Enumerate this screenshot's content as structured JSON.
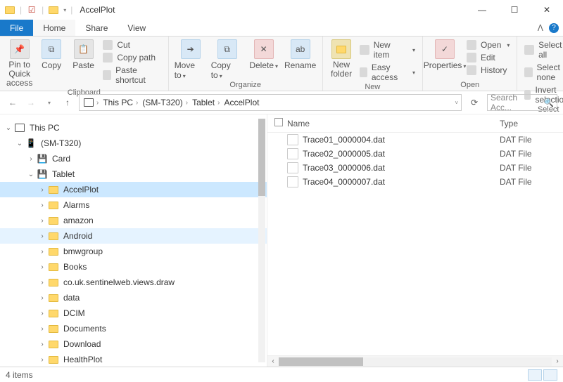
{
  "title": "AccelPlot",
  "tabs": {
    "file": "File",
    "home": "Home",
    "share": "Share",
    "view": "View"
  },
  "ribbon": {
    "clipboard": {
      "label": "Clipboard",
      "pin": "Pin to Quick access",
      "copy": "Copy",
      "paste": "Paste",
      "cut": "Cut",
      "copypath": "Copy path",
      "pasteshortcut": "Paste shortcut"
    },
    "organize": {
      "label": "Organize",
      "moveto": "Move to",
      "copyto": "Copy to",
      "delete": "Delete",
      "rename": "Rename"
    },
    "new": {
      "label": "New",
      "newfolder": "New folder",
      "newitem": "New item",
      "easyaccess": "Easy access"
    },
    "open": {
      "label": "Open",
      "properties": "Properties",
      "open": "Open",
      "edit": "Edit",
      "history": "History"
    },
    "select": {
      "label": "Select",
      "selectall": "Select all",
      "selectnone": "Select none",
      "invert": "Invert selection"
    }
  },
  "path": [
    "This PC",
    "(SM-T320)",
    "Tablet",
    "AccelPlot"
  ],
  "search_placeholder": "Search Acc...",
  "tree": {
    "thispc": "This PC",
    "device": "(SM-T320)",
    "card": "Card",
    "tablet": "Tablet",
    "folders": [
      "AccelPlot",
      "Alarms",
      "amazon",
      "Android",
      "bmwgroup",
      "Books",
      "co.uk.sentinelweb.views.draw",
      "data",
      "DCIM",
      "Documents",
      "Download",
      "HealthPlot"
    ]
  },
  "columns": {
    "name": "Name",
    "type": "Type"
  },
  "files": [
    {
      "name": "Trace01_0000004.dat",
      "type": "DAT File"
    },
    {
      "name": "Trace02_0000005.dat",
      "type": "DAT File"
    },
    {
      "name": "Trace03_0000006.dat",
      "type": "DAT File"
    },
    {
      "name": "Trace04_0000007.dat",
      "type": "DAT File"
    }
  ],
  "status": "4 items"
}
